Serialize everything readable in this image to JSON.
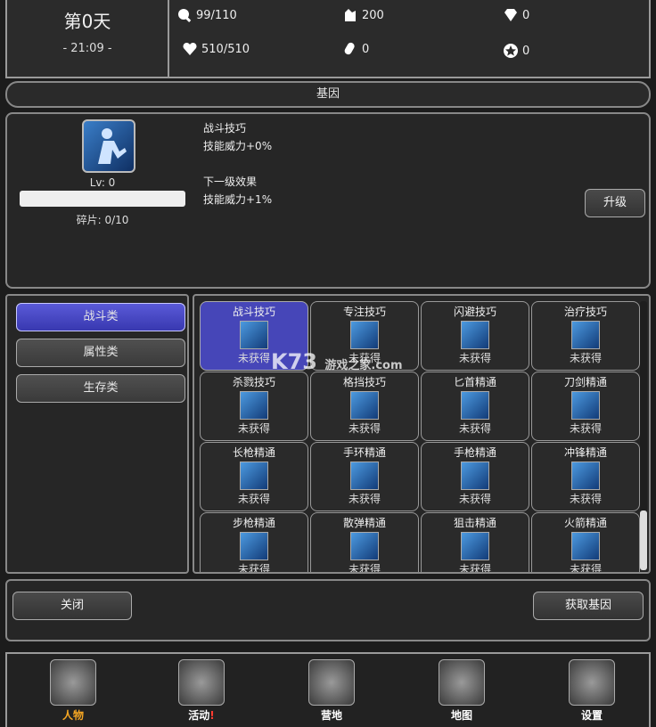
{
  "top": {
    "day": "第0天",
    "time": "- 21:09 -",
    "stats": {
      "food": "99/110",
      "ammo": "200",
      "diamond": "0",
      "health": "510/510",
      "capsule": "0",
      "star": "0"
    }
  },
  "title": "基因",
  "detail": {
    "level": "Lv: 0",
    "fragments": "碎片: 0/10",
    "skill_name": "战斗技巧",
    "effect": "技能威力+0%",
    "next_label": "下一级效果",
    "next_effect": "技能威力+1%",
    "upgrade": "升级"
  },
  "categories": [
    "战斗类",
    "属性类",
    "生存类"
  ],
  "skills": [
    {
      "name": "战斗技巧",
      "status": "未获得"
    },
    {
      "name": "专注技巧",
      "status": "未获得"
    },
    {
      "name": "闪避技巧",
      "status": "未获得"
    },
    {
      "name": "治疗技巧",
      "status": "未获得"
    },
    {
      "name": "杀戮技巧",
      "status": "未获得"
    },
    {
      "name": "格挡技巧",
      "status": "未获得"
    },
    {
      "name": "匕首精通",
      "status": "未获得"
    },
    {
      "name": "刀剑精通",
      "status": "未获得"
    },
    {
      "name": "长枪精通",
      "status": "未获得"
    },
    {
      "name": "手环精通",
      "status": "未获得"
    },
    {
      "name": "手枪精通",
      "status": "未获得"
    },
    {
      "name": "冲锋精通",
      "status": "未获得"
    },
    {
      "name": "步枪精通",
      "status": "未获得"
    },
    {
      "name": "散弹精通",
      "status": "未获得"
    },
    {
      "name": "狙击精通",
      "status": "未获得"
    },
    {
      "name": "火箭精通",
      "status": "未获得"
    }
  ],
  "bottom": {
    "close": "关闭",
    "get_gene": "获取基因"
  },
  "nav": {
    "character": "人物",
    "activity": "活动",
    "activity_alert": "!",
    "camp": "营地",
    "map": "地图",
    "settings": "设置"
  },
  "watermark": {
    "logo": "K73",
    "site": "游戏之家",
    "domain": ".com"
  },
  "colors": {
    "accent": "#4646b8",
    "nav_active": "#f5a623",
    "alert": "#ff3b30"
  }
}
